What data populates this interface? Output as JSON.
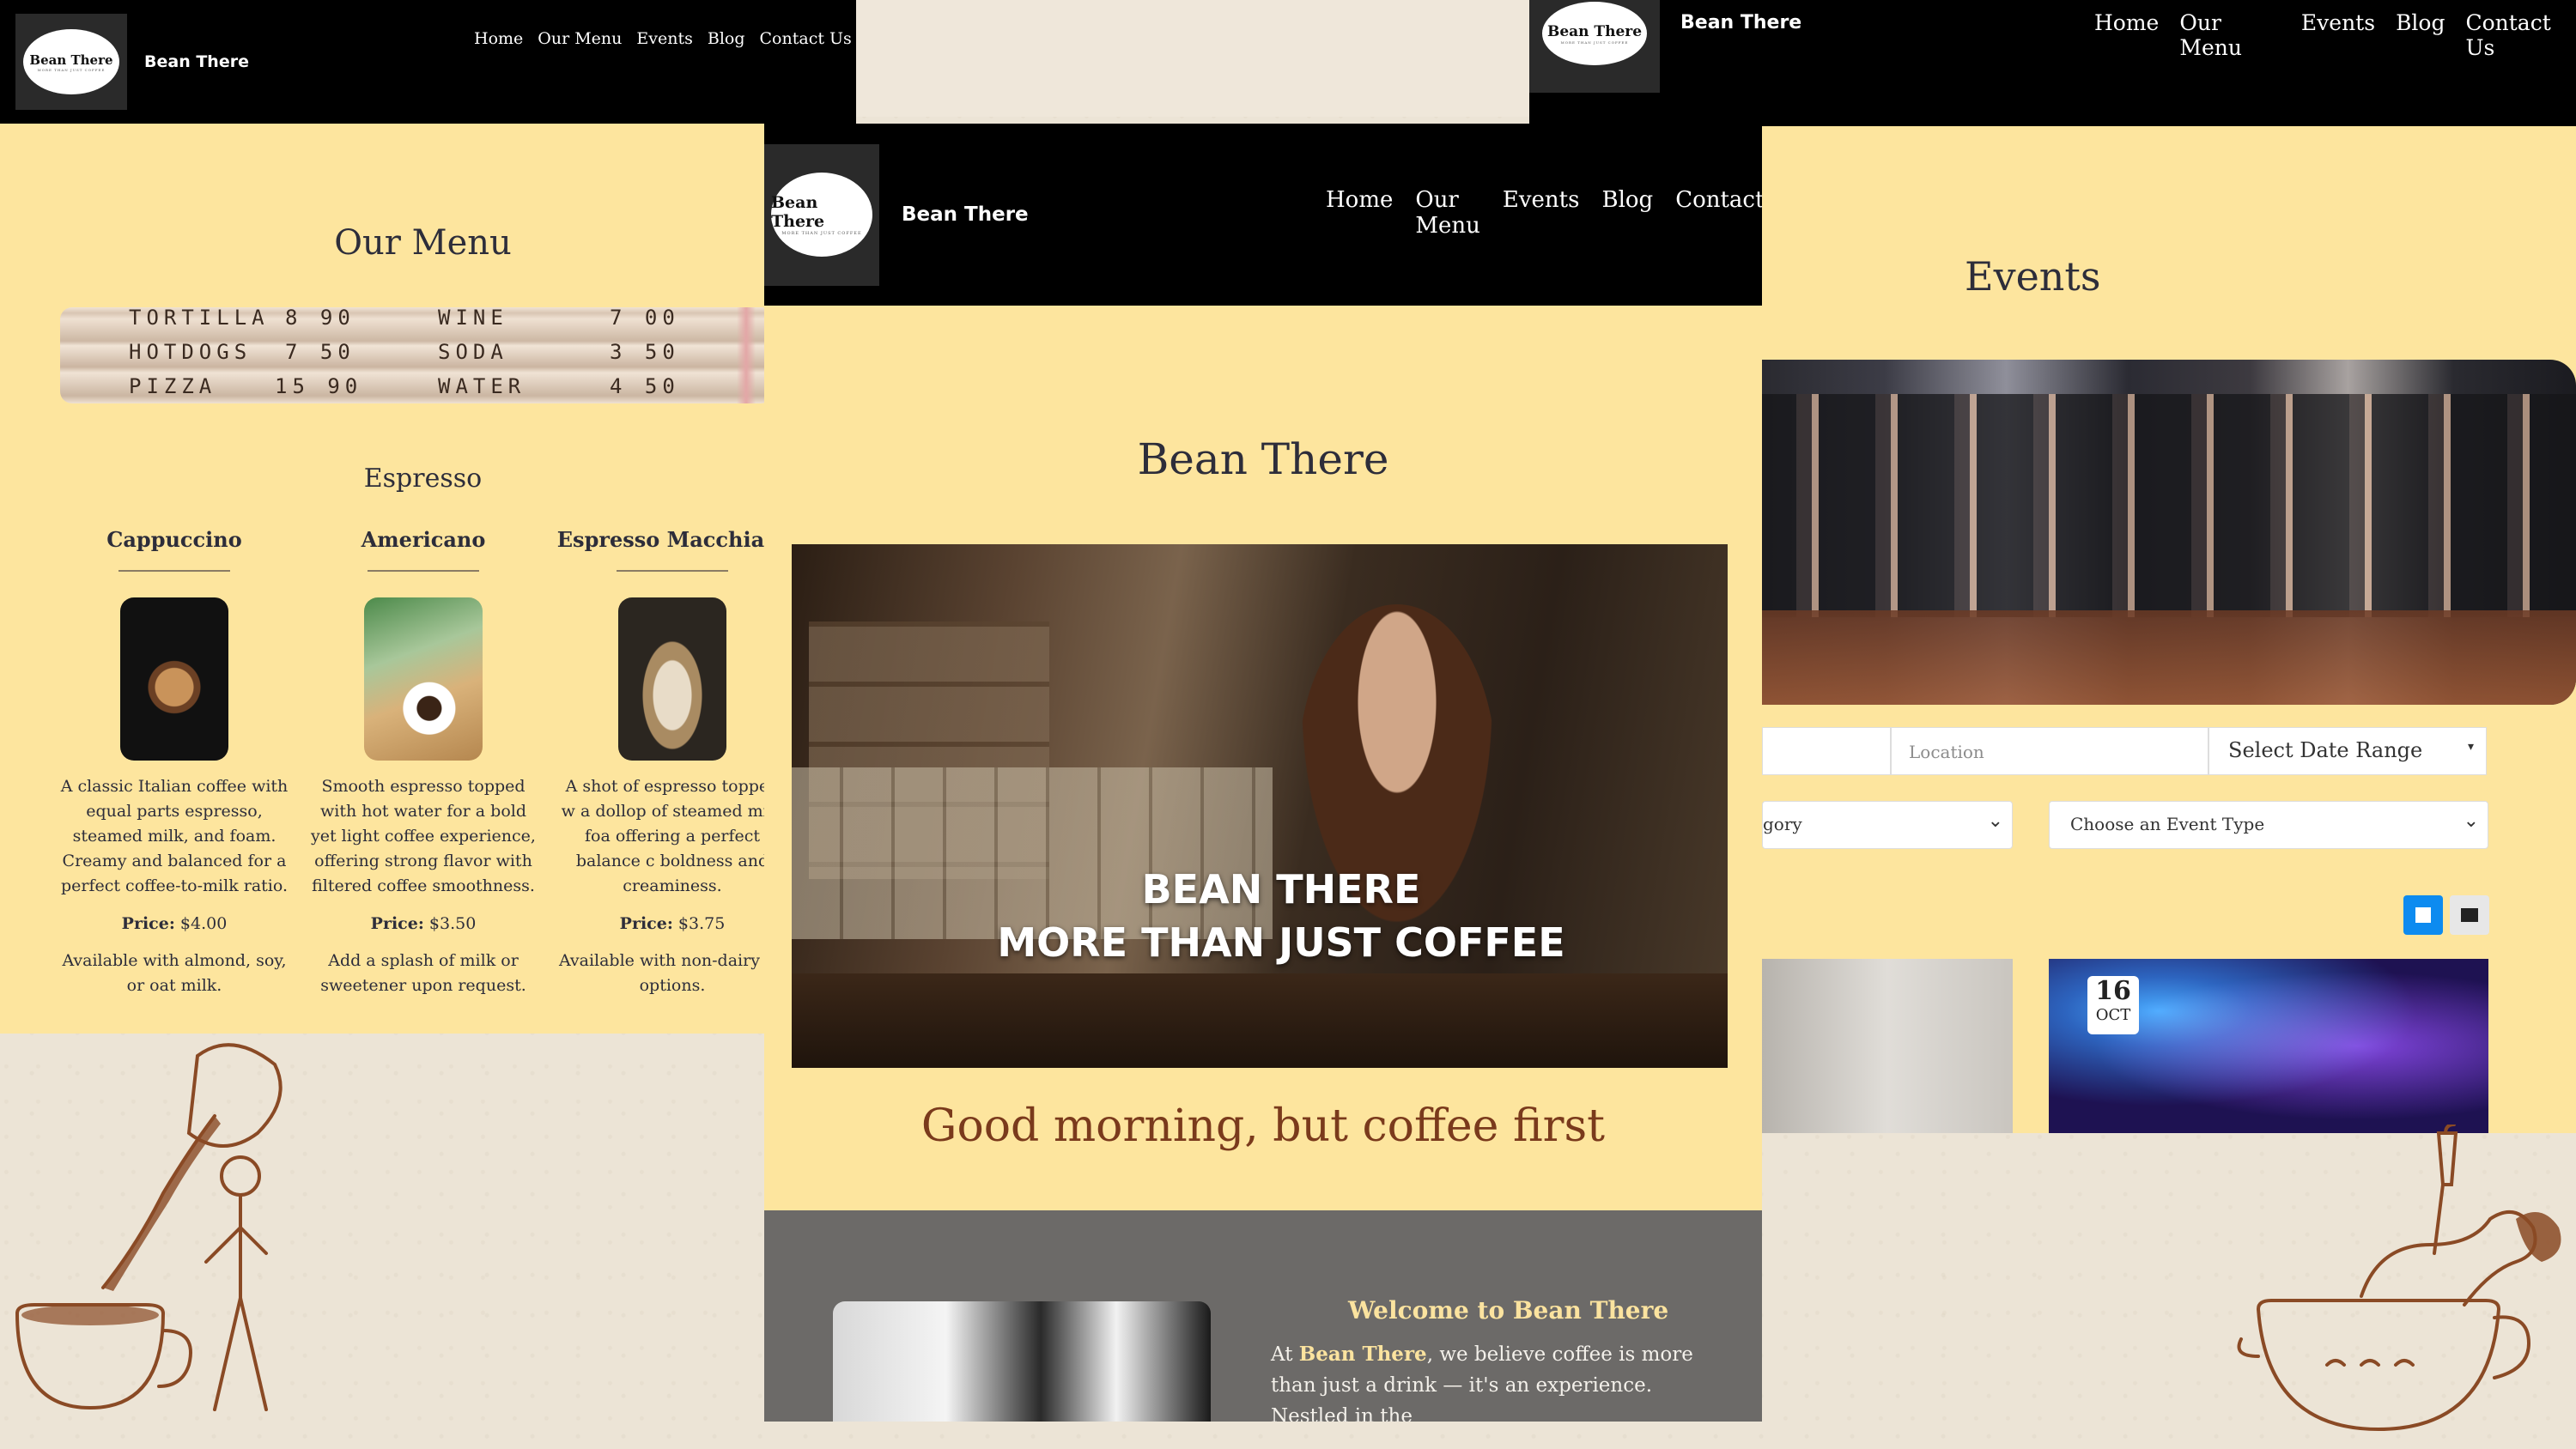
{
  "brand": {
    "name": "Bean There",
    "logo_text": "Bean There",
    "logo_tagline": "MORE THAN JUST COFFEE"
  },
  "nav": {
    "items": [
      "Home",
      "Our Menu",
      "Events",
      "Blog",
      "Contact Us"
    ],
    "center_items": [
      "Home",
      "Our Menu",
      "Events",
      "Blog",
      "Contact"
    ]
  },
  "menu_page": {
    "title": "Our Menu",
    "board_rows": [
      {
        "item": "TORTILLA",
        "price": "8 90",
        "item2": "WINE",
        "price2": "7 00"
      },
      {
        "item": "HOTDOGS",
        "price": "7 50",
        "item2": "SODA",
        "price2": "3 50"
      },
      {
        "item": "PIZZA",
        "price": "15 90",
        "item2": "WATER",
        "price2": "4 50"
      }
    ],
    "section_title": "Espresso",
    "items": [
      {
        "name": "Cappuccino",
        "description": "A classic Italian coffee with equal parts espresso, steamed milk, and foam. Creamy and balanced for a perfect coffee-to-milk ratio.",
        "price_label": "Price:",
        "price": "$4.00",
        "note": "Available with almond, soy, or oat milk."
      },
      {
        "name": "Americano",
        "description": "Smooth espresso topped with hot water for a bold yet light coffee experience, offering strong flavor with filtered coffee smoothness.",
        "price_label": "Price:",
        "price": "$3.50",
        "note": "Add a splash of milk or sweetener upon request."
      },
      {
        "name": "Espresso Macchiato",
        "description": "A shot of espresso topped w a dollop of steamed milk foa offering a perfect balance c boldness and creaminess.",
        "price_label": "Price:",
        "price": "$3.75",
        "note": "Available with non-dairy mi options."
      }
    ]
  },
  "home_page": {
    "title": "Bean There",
    "hero_line1": "BEAN THERE",
    "hero_line2": "MORE THAN JUST COFFEE",
    "tagline": "Good morning, but coffee first",
    "welcome_title": "Welcome to Bean There",
    "welcome_prefix": "At ",
    "welcome_brand": "Bean There",
    "welcome_text": ", we believe coffee is more than just a drink — it's an experience. Nestled in the"
  },
  "events_page": {
    "title": "Events",
    "location_placeholder": "Location",
    "date_range": "Select Date Range",
    "category_select": "gory",
    "event_type_select": "Choose an Event Type",
    "event_day": "16",
    "event_month": "OCT"
  },
  "colors": {
    "panel_bg": "#fde59e",
    "nav_bg": "#000000",
    "tagline": "#7a3a1c",
    "welcome_bg": "#6c6a68",
    "accent_blue": "#0d8bf0"
  }
}
